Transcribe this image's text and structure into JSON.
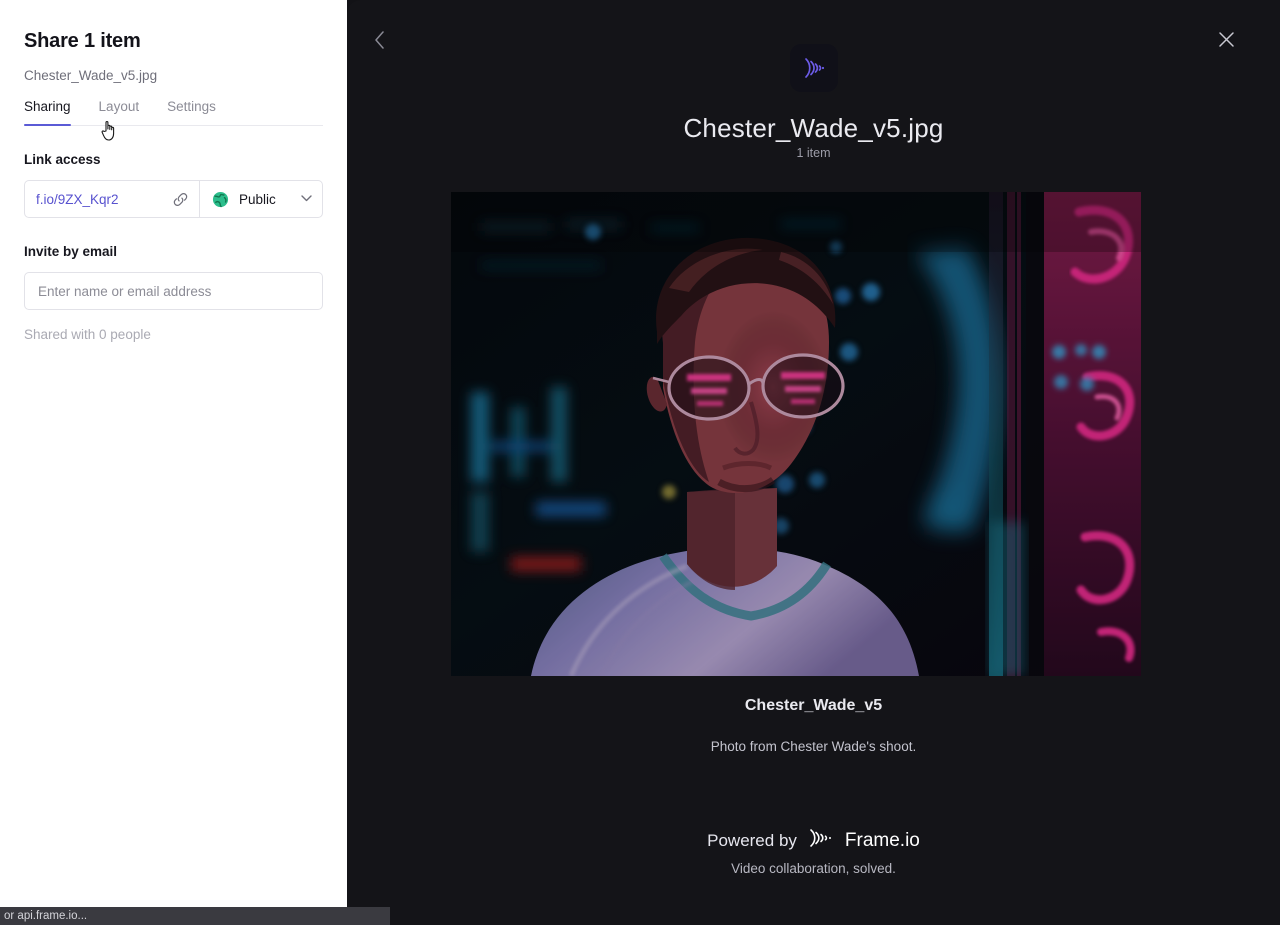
{
  "app": {
    "help_label": "?",
    "chevron_label": "⌄",
    "overflow_label": "• • •"
  },
  "share_panel": {
    "title": "Share 1 item",
    "filename": "Chester_Wade_v5.jpg",
    "tabs": [
      {
        "label": "Sharing",
        "active": true
      },
      {
        "label": "Layout",
        "active": false
      },
      {
        "label": "Settings",
        "active": false
      }
    ],
    "link_access": {
      "label": "Link access",
      "url": "f.io/9ZX_Kqr2",
      "link_icon": "link-icon",
      "globe_icon": "globe-icon",
      "access_value": "Public",
      "caret": "⌄",
      "accent_color": "#5852cf",
      "globe_color": "#2cbe8c"
    },
    "invite": {
      "label": "Invite by email",
      "placeholder": "Enter name or email address",
      "value": "",
      "shared_with": "Shared with 0 people"
    },
    "active_tab_underline_color": "#5b5bd6"
  },
  "preview": {
    "back_icon": "chevron-left-icon",
    "close_icon": "close-icon",
    "logo_icon": "frameio-logo-icon",
    "title": "Chester_Wade_v5.jpg",
    "item_count": "1 item",
    "asset_name": "Chester_Wade_v5",
    "asset_description": "Photo from Chester Wade's shoot.",
    "powered_by": "Powered by",
    "brand": "Frame.io",
    "tagline": "Video collaboration, solved.",
    "logo_color": "#6c5ce7"
  },
  "status_bar": {
    "text": "or api.frame.io..."
  }
}
